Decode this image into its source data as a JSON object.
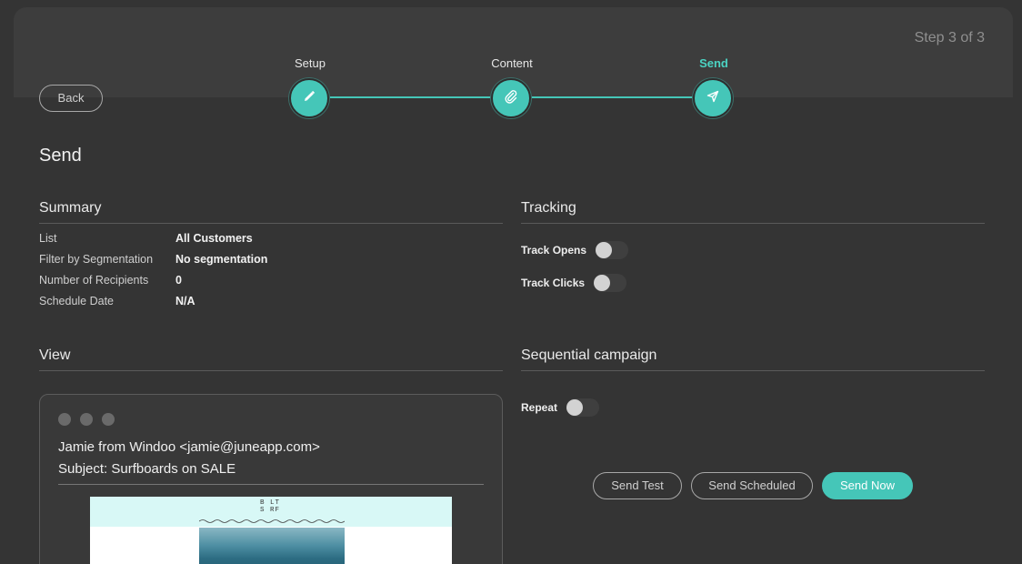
{
  "header": {
    "step_counter": "Step 3 of 3",
    "back_label": "Back"
  },
  "stepper": {
    "steps": [
      {
        "label": "Setup",
        "icon": "pencil-icon",
        "active": false
      },
      {
        "label": "Content",
        "icon": "paperclip-icon",
        "active": false
      },
      {
        "label": "Send",
        "icon": "send-arrow-icon",
        "active": true
      }
    ],
    "accent_color": "#45c6b8"
  },
  "page_title": "Send",
  "summary": {
    "heading": "Summary",
    "rows": [
      {
        "label": "List",
        "value": "All Customers"
      },
      {
        "label": "Filter by Segmentation",
        "value": "No segmentation"
      },
      {
        "label": "Number of Recipients",
        "value": "0"
      },
      {
        "label": "Schedule Date",
        "value": "N/A"
      }
    ]
  },
  "tracking": {
    "heading": "Tracking",
    "toggles": [
      {
        "label": "Track Opens",
        "on": false
      },
      {
        "label": "Track Clicks",
        "on": false
      }
    ]
  },
  "view": {
    "heading": "View",
    "from": "Jamie from Windoo <jamie@juneapp.com>",
    "subject": "Subject: Surfboards on SALE",
    "brand_logo_line1": "B LT",
    "brand_logo_line2": "S RF"
  },
  "sequential": {
    "heading": "Sequential campaign",
    "toggles": [
      {
        "label": "Repeat",
        "on": false
      }
    ]
  },
  "actions": {
    "send_test": "Send Test",
    "send_scheduled": "Send Scheduled",
    "send_now": "Send Now"
  }
}
